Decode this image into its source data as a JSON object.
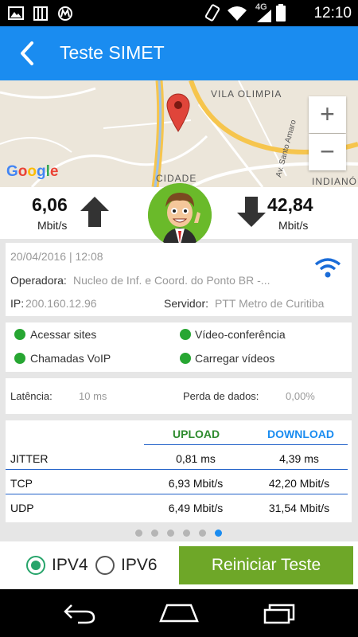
{
  "status_bar": {
    "time": "12:10",
    "network": "4G",
    "icons": [
      "image-icon",
      "grid-icon",
      "motorola-icon",
      "rotate-icon",
      "wifi-icon",
      "signal-icon",
      "battery-icon"
    ]
  },
  "app_bar": {
    "title": "Teste SIMET",
    "back_icon": "back-arrow-icon",
    "color": "#1a8cf0"
  },
  "map": {
    "labels": [
      "VILA OLIMPIA",
      "CIDADE",
      "Av. Santo Amaro",
      "INDIANÓPO"
    ],
    "logo": "Google",
    "zoom_in": "+",
    "zoom_out": "−"
  },
  "speed": {
    "upload_value": "6,06",
    "upload_unit": "Mbit/s",
    "download_value": "42,84",
    "download_unit": "Mbit/s"
  },
  "info": {
    "datetime": "20/04/2016 | 12:08",
    "operator_label": "Operadora:",
    "operator_value": "Nucleo de Inf. e Coord. do Ponto BR -...",
    "ip_label": "IP:",
    "ip_value": "200.160.12.96",
    "server_label": "Servidor:",
    "server_value": "PTT Metro de Curitiba"
  },
  "capabilities": [
    {
      "label": "Acessar sites",
      "status_color": "#27a632"
    },
    {
      "label": "Vídeo-conferência",
      "status_color": "#27a632"
    },
    {
      "label": "Chamadas VoIP",
      "status_color": "#27a632"
    },
    {
      "label": "Carregar vídeos",
      "status_color": "#27a632"
    }
  ],
  "metrics": {
    "latency_label": "Latência:",
    "latency_value": "10 ms",
    "loss_label": "Perda de dados:",
    "loss_value": "0,00%"
  },
  "table": {
    "headers": [
      "UPLOAD",
      "DOWNLOAD"
    ],
    "header_colors": [
      "#2e8b2e",
      "#1a8cf0"
    ],
    "rows": [
      {
        "label": "JITTER",
        "upload": "0,81 ms",
        "download": "4,39 ms"
      },
      {
        "label": "TCP",
        "upload": "6,93 Mbit/s",
        "download": "42,20 Mbit/s"
      },
      {
        "label": "UDP",
        "upload": "6,49 Mbit/s",
        "download": "31,54 Mbit/s"
      }
    ]
  },
  "pager": {
    "count": 6,
    "active_index": 5
  },
  "controls": {
    "ipv4_label": "IPV4",
    "ipv6_label": "IPV6",
    "selected": "IPV4",
    "restart_label": "Reiniciar Teste",
    "restart_color": "#6ea728"
  }
}
